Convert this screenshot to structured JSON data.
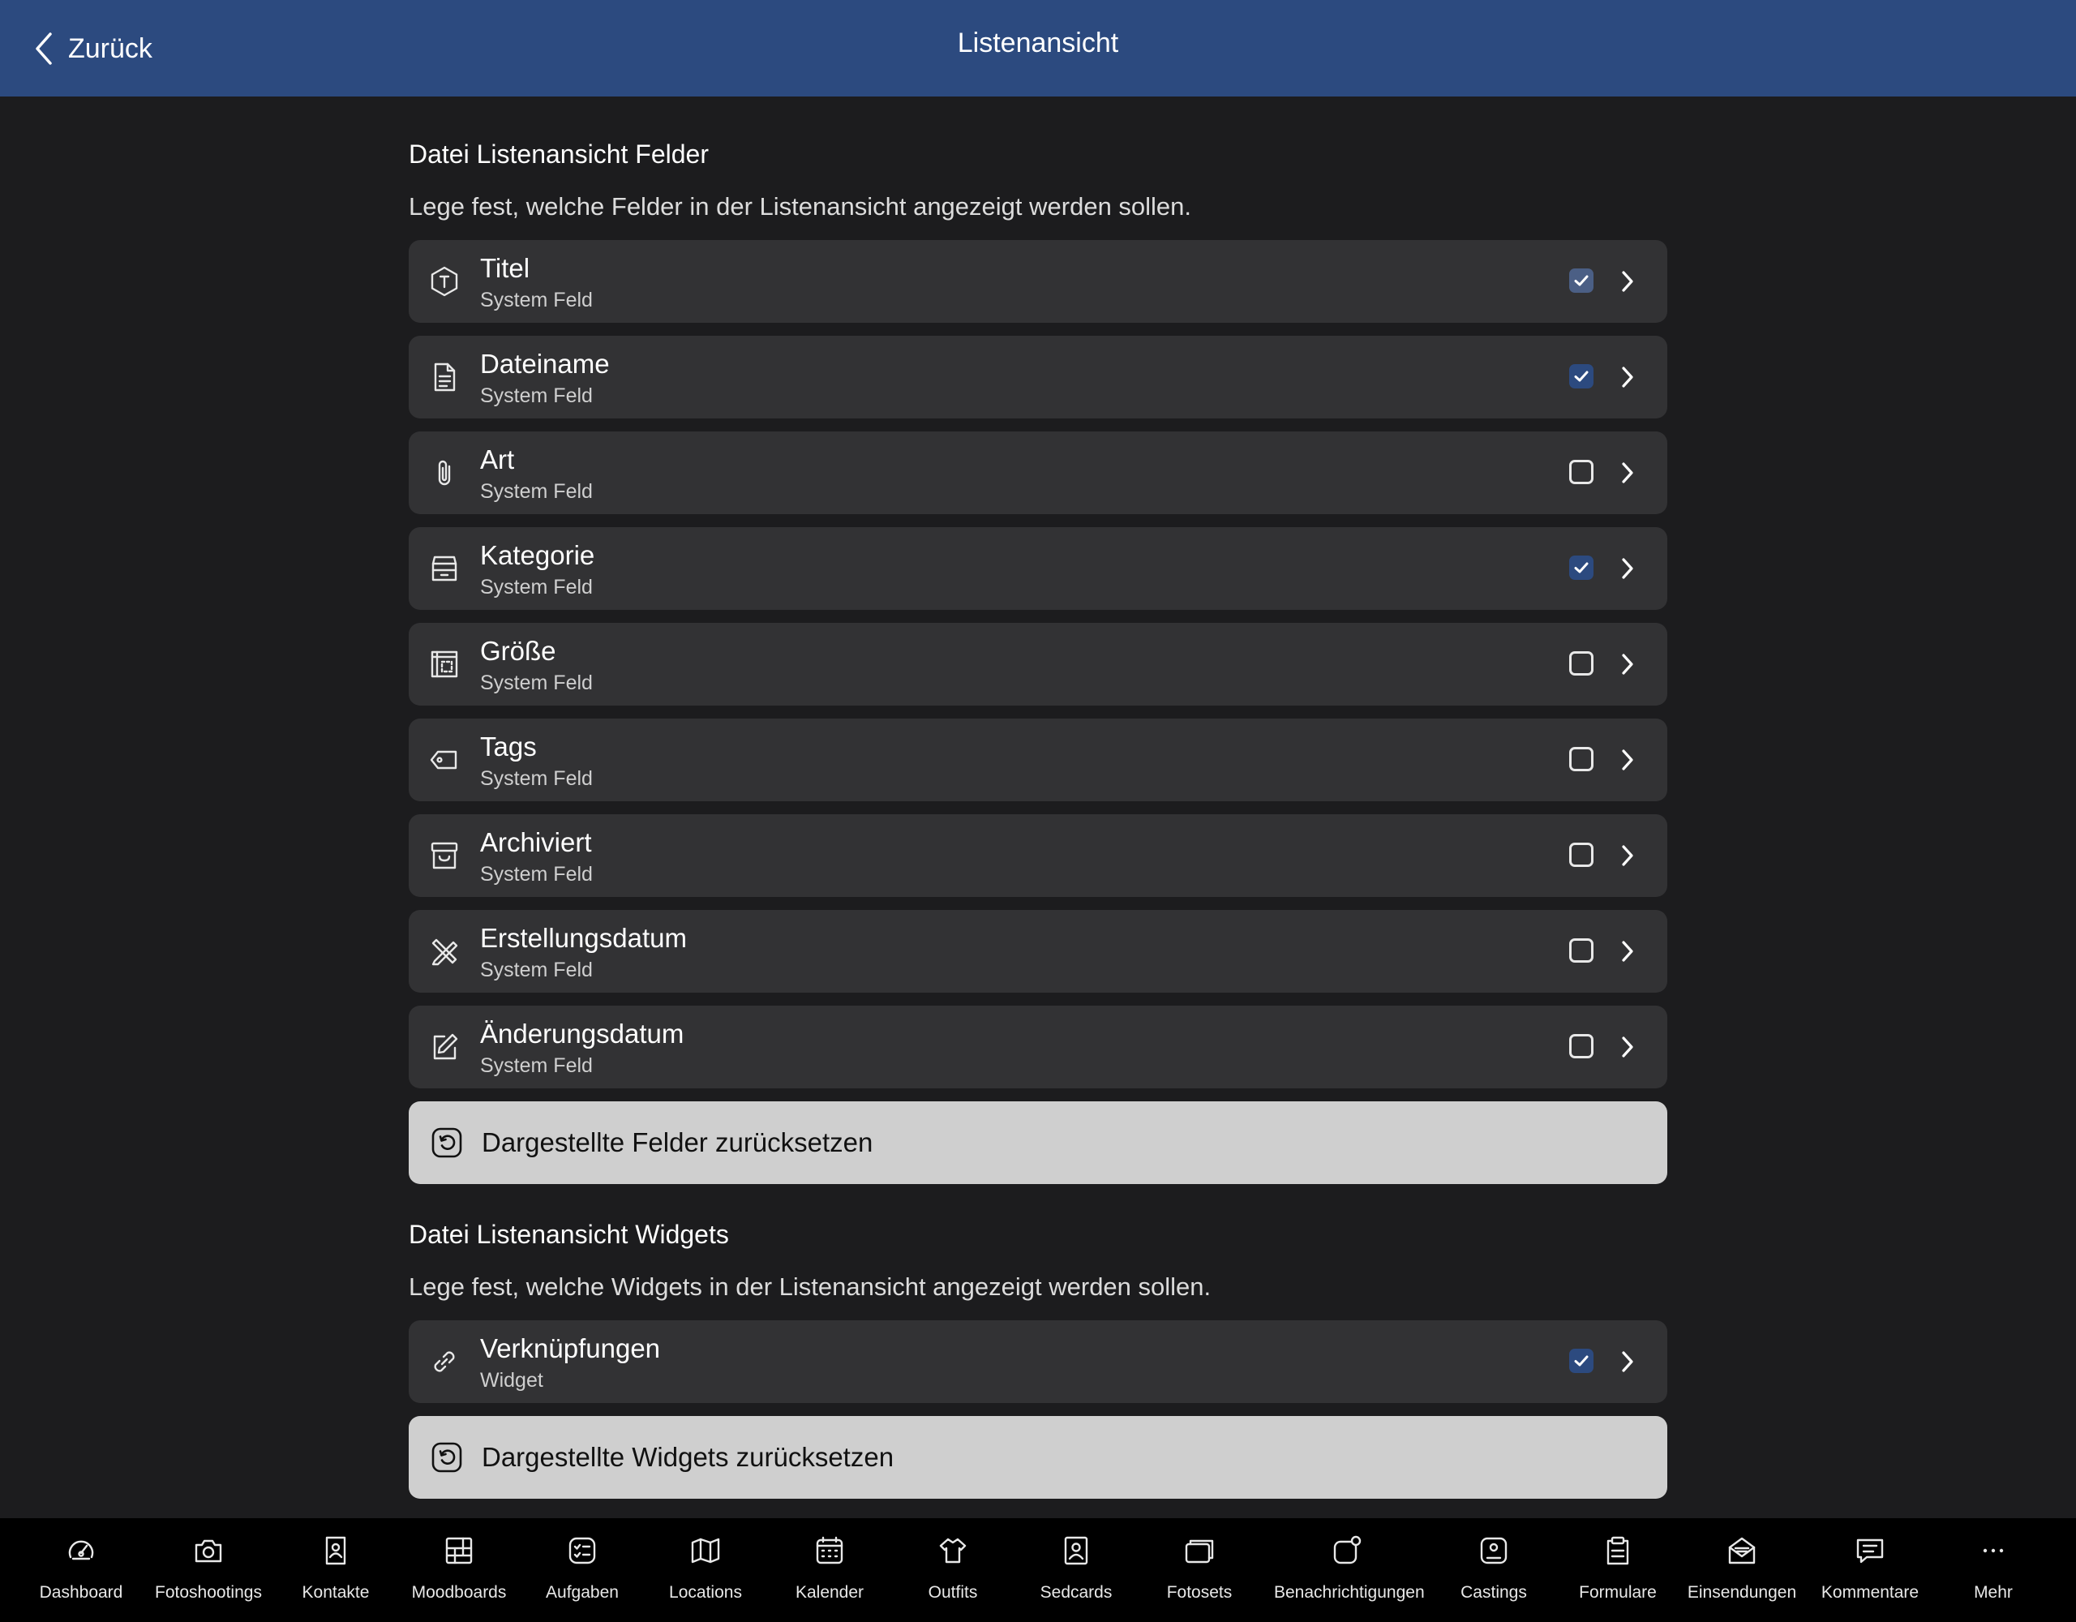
{
  "header": {
    "back_label": "Zurück",
    "title": "Listenansicht"
  },
  "fields_section": {
    "title": "Datei Listenansicht Felder",
    "description": "Lege fest, welche Felder in der Listenansicht angezeigt werden sollen.",
    "items": [
      {
        "label": "Titel",
        "sub": "System Feld",
        "checked": true,
        "icon": "title-badge-icon"
      },
      {
        "label": "Dateiname",
        "sub": "System Feld",
        "checked": true,
        "icon": "document-icon"
      },
      {
        "label": "Art",
        "sub": "System Feld",
        "checked": false,
        "icon": "paperclip-icon"
      },
      {
        "label": "Kategorie",
        "sub": "System Feld",
        "checked": true,
        "icon": "tray-icon"
      },
      {
        "label": "Größe",
        "sub": "System Feld",
        "checked": false,
        "icon": "dimensions-icon"
      },
      {
        "label": "Tags",
        "sub": "System Feld",
        "checked": false,
        "icon": "tag-icon"
      },
      {
        "label": "Archiviert",
        "sub": "System Feld",
        "checked": false,
        "icon": "archive-icon"
      },
      {
        "label": "Erstellungsdatum",
        "sub": "System Feld",
        "checked": false,
        "icon": "pencil-ruler-icon"
      },
      {
        "label": "Änderungsdatum",
        "sub": "System Feld",
        "checked": false,
        "icon": "edit-icon"
      }
    ],
    "reset_label": "Dargestellte Felder zurücksetzen"
  },
  "widgets_section": {
    "title": "Datei Listenansicht Widgets",
    "description": "Lege fest, welche Widgets in der Listenansicht angezeigt werden sollen.",
    "items": [
      {
        "label": "Verknüpfungen",
        "sub": "Widget",
        "checked": true,
        "icon": "link-icon"
      }
    ],
    "reset_label": "Dargestellte Widgets zurücksetzen"
  },
  "tabbar": [
    {
      "label": "Dashboard",
      "icon": "speedometer-icon"
    },
    {
      "label": "Fotoshootings",
      "icon": "camera-icon"
    },
    {
      "label": "Kontakte",
      "icon": "contact-icon"
    },
    {
      "label": "Moodboards",
      "icon": "moodboard-icon"
    },
    {
      "label": "Aufgaben",
      "icon": "checklist-icon"
    },
    {
      "label": "Locations",
      "icon": "map-icon"
    },
    {
      "label": "Kalender",
      "icon": "calendar-icon"
    },
    {
      "label": "Outfits",
      "icon": "shirt-icon"
    },
    {
      "label": "Sedcards",
      "icon": "sedcard-icon"
    },
    {
      "label": "Fotosets",
      "icon": "photoset-icon"
    },
    {
      "label": "Benachrichtigungen",
      "icon": "notification-icon"
    },
    {
      "label": "Castings",
      "icon": "casting-icon"
    },
    {
      "label": "Formulare",
      "icon": "clipboard-icon"
    },
    {
      "label": "Einsendungen",
      "icon": "mail-icon"
    },
    {
      "label": "Kommentare",
      "icon": "comment-icon"
    },
    {
      "label": "Mehr",
      "icon": "more-icon"
    }
  ],
  "colors": {
    "header_bg": "#2c4a7f",
    "page_bg": "#1c1c1e",
    "row_bg": "#323234",
    "reset_bg": "#cfcfcf",
    "checked": "#2c4a7f"
  }
}
